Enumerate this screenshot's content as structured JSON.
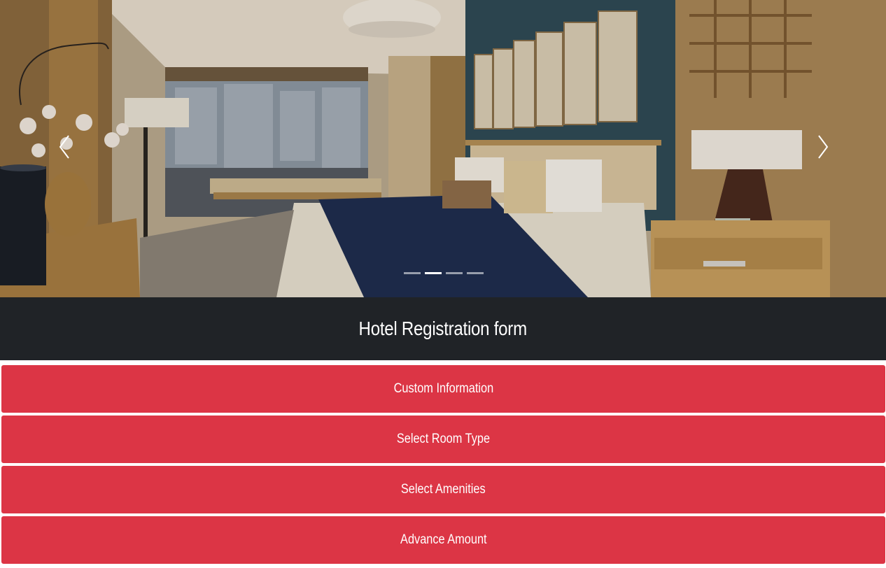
{
  "carousel": {
    "image_alt": "hotel-bedroom",
    "prev_icon": "chevron-left-icon",
    "next_icon": "chevron-right-icon",
    "indicators": [
      {
        "active": false
      },
      {
        "active": true
      },
      {
        "active": false
      },
      {
        "active": false
      }
    ]
  },
  "header": {
    "title": "Hotel Registration form"
  },
  "sections": [
    {
      "label": "Custom Information"
    },
    {
      "label": "Select Room Type"
    },
    {
      "label": "Select Amenities"
    },
    {
      "label": "Advance Amount"
    }
  ],
  "colors": {
    "section_bg": "#dc3545",
    "header_bg": "#202327",
    "text": "#ffffff"
  }
}
